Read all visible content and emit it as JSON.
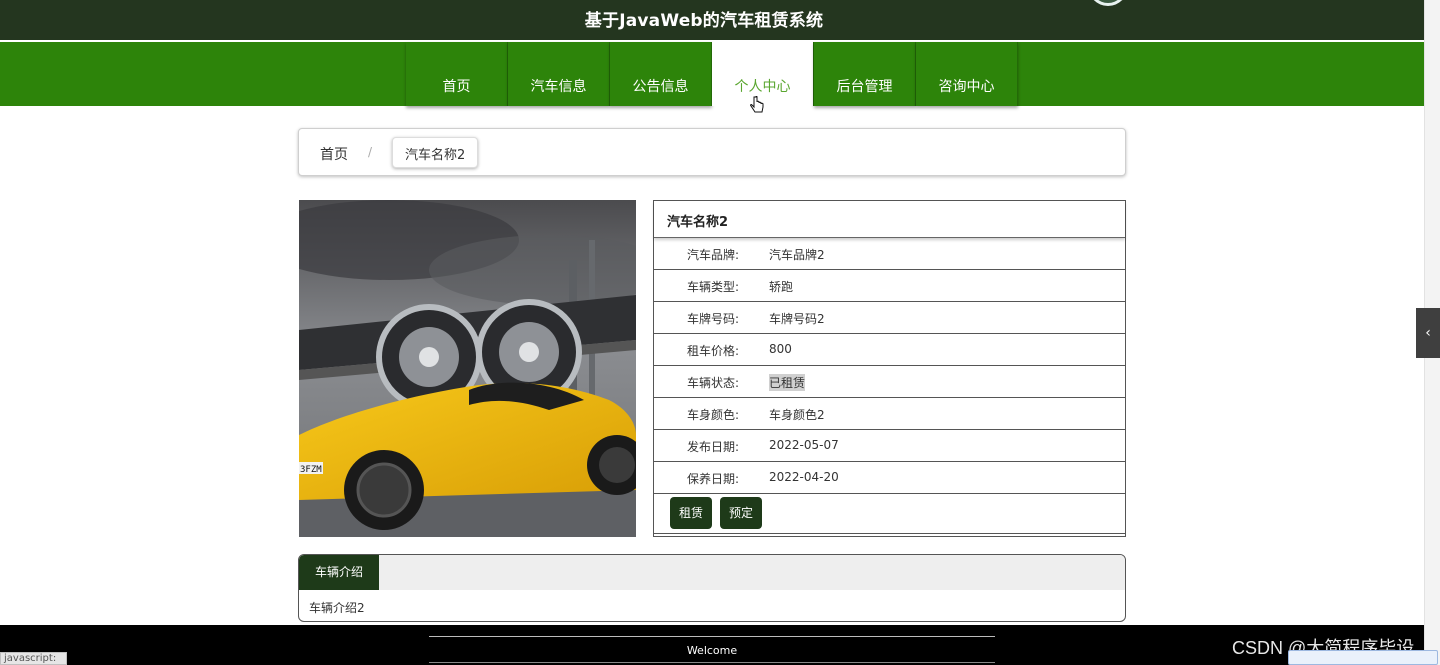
{
  "header": {
    "site_title": "基于JavaWeb的汽车租赁系统"
  },
  "nav": {
    "items": [
      "首页",
      "汽车信息",
      "公告信息",
      "个人中心",
      "后台管理",
      "咨询中心"
    ],
    "active": "个人中心"
  },
  "breadcrumb": {
    "home": "首页",
    "separator": "/",
    "current": "汽车名称2"
  },
  "detail": {
    "title": "汽车名称2",
    "rows": [
      {
        "label": "汽车品牌:",
        "value": "汽车品牌2"
      },
      {
        "label": "车辆类型:",
        "value": "轿跑"
      },
      {
        "label": "车牌号码:",
        "value": "车牌号码2"
      },
      {
        "label": "租车价格:",
        "value": "800"
      },
      {
        "label": "车辆状态:",
        "value": "已租赁"
      },
      {
        "label": "车身颜色:",
        "value": "车身颜色2"
      },
      {
        "label": "发布日期:",
        "value": "2022-05-07"
      },
      {
        "label": "保养日期:",
        "value": "2022-04-20"
      }
    ],
    "buttons": {
      "rent": "租赁",
      "reserve": "预定"
    }
  },
  "intro": {
    "tab_label": "车辆介绍",
    "content": "车辆介绍2"
  },
  "car_image": {
    "plate_text": "3FZM"
  },
  "footer": {
    "text": "Welcome"
  },
  "status_bar": {
    "text": "javascript:"
  },
  "watermark": {
    "text": "CSDN @大简程序毕设"
  },
  "colors": {
    "nav_green": "#2d840a",
    "dark_green": "#1e3a19",
    "topbar": "#24361f",
    "active_nav_text": "#5aa630"
  },
  "icons": {
    "side_tab": "chevron-left-icon",
    "cursor": "hand-pointer-icon"
  }
}
